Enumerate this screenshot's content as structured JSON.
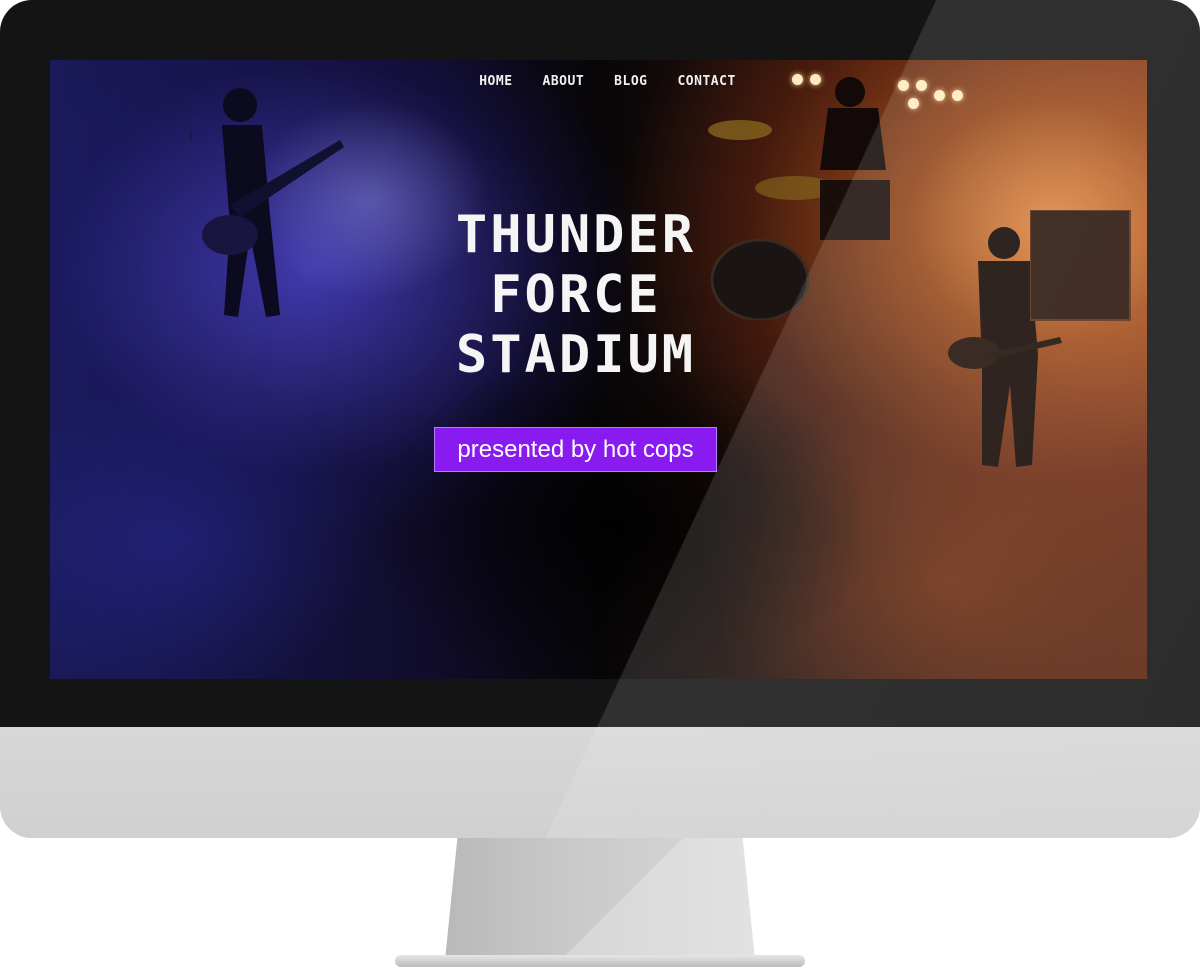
{
  "site": {
    "nav": {
      "items": [
        {
          "label": "HOME"
        },
        {
          "label": "ABOUT"
        },
        {
          "label": "BLOG"
        },
        {
          "label": "CONTACT"
        }
      ]
    },
    "hero": {
      "title_lines": [
        "THUNDER",
        "FORCE",
        "STADIUM"
      ],
      "badge": "presented by hot cops"
    }
  },
  "colors": {
    "badge_bg": "#8a1bf0",
    "bezel": "#141414",
    "chin": "#d3d3d3",
    "text": "#f5f5f5"
  }
}
